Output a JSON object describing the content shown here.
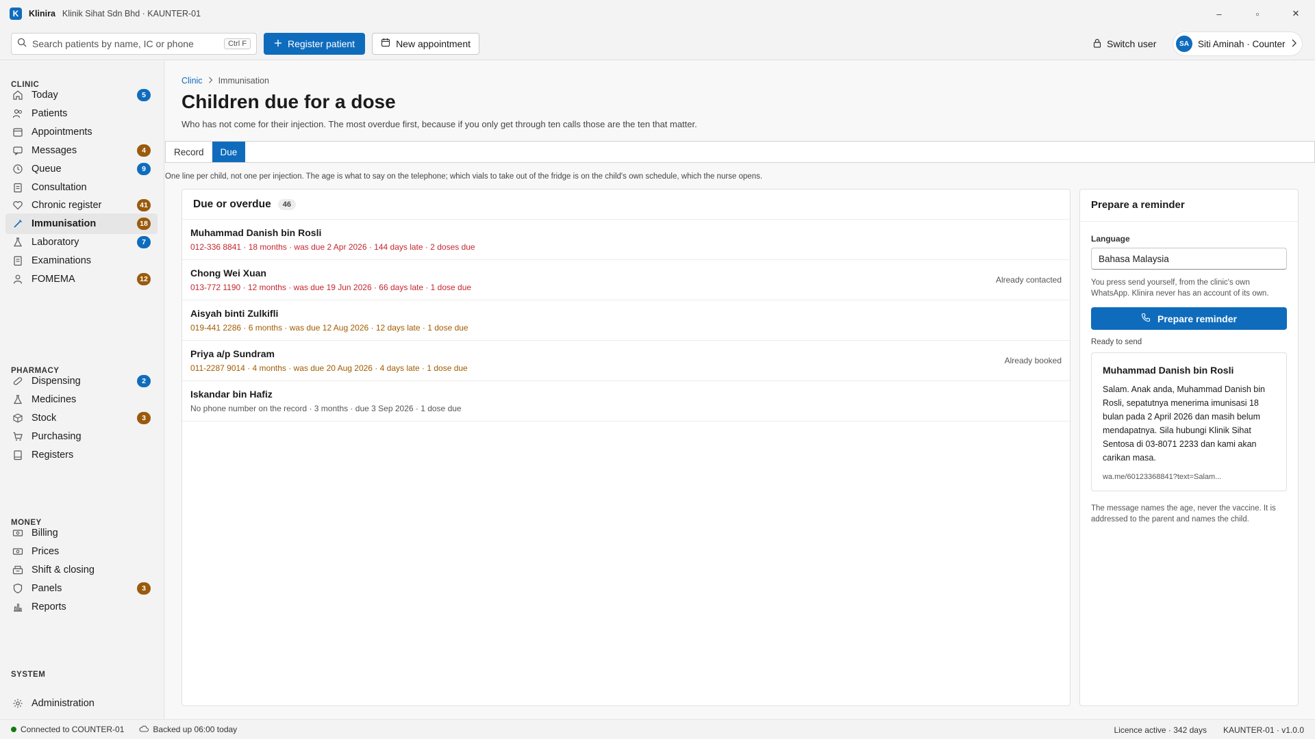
{
  "app": {
    "logo_letter": "K",
    "name": "Klinira",
    "subtitle": "Klinik Sihat Sdn Bhd · KAUNTER-01",
    "window_controls": {
      "minimize": "–",
      "maximize": "▫",
      "close": "✕"
    }
  },
  "toolbar": {
    "search_placeholder": "Search patients by name, IC or phone",
    "search_shortcut": "Ctrl F",
    "register_label": "Register patient",
    "appointment_label": "New appointment",
    "switch_user_label": "Switch user",
    "user_initials": "SA",
    "user_name": "Siti Aminah · Counter"
  },
  "sidebar": {
    "clinic_header": "CLINIC",
    "clinic_items": [
      {
        "label": "Today",
        "icon": "home-icon",
        "badge": "5",
        "badge_color": "blue"
      },
      {
        "label": "Patients",
        "icon": "people-icon",
        "badge": "",
        "badge_color": ""
      },
      {
        "label": "Appointments",
        "icon": "calendar-icon",
        "badge": "",
        "badge_color": ""
      },
      {
        "label": "Messages",
        "icon": "chat-icon",
        "badge": "4",
        "badge_color": "brown"
      },
      {
        "label": "Queue",
        "icon": "clock-icon",
        "badge": "9",
        "badge_color": "blue"
      },
      {
        "label": "Consultation",
        "icon": "clipboard-icon",
        "badge": "",
        "badge_color": ""
      },
      {
        "label": "Chronic register",
        "icon": "heart-icon",
        "badge": "41",
        "badge_color": "brown"
      },
      {
        "label": "Immunisation",
        "icon": "syringe-icon",
        "badge": "18",
        "badge_color": "brown",
        "active": true
      },
      {
        "label": "Laboratory",
        "icon": "flask-icon",
        "badge": "7",
        "badge_color": "blue"
      },
      {
        "label": "Examinations",
        "icon": "document-icon",
        "badge": "",
        "badge_color": ""
      },
      {
        "label": "FOMEMA",
        "icon": "person-icon",
        "badge": "12",
        "badge_color": "brown"
      }
    ],
    "pharmacy_header": "PHARMACY",
    "pharmacy_items": [
      {
        "label": "Dispensing",
        "icon": "pill-icon",
        "badge": "2",
        "badge_color": "blue"
      },
      {
        "label": "Medicines",
        "icon": "flask-icon",
        "badge": "",
        "badge_color": ""
      },
      {
        "label": "Stock",
        "icon": "box-icon",
        "badge": "3",
        "badge_color": "brown"
      },
      {
        "label": "Purchasing",
        "icon": "cart-icon",
        "badge": "",
        "badge_color": ""
      },
      {
        "label": "Registers",
        "icon": "book-icon",
        "badge": "",
        "badge_color": ""
      }
    ],
    "money_header": "MONEY",
    "money_items": [
      {
        "label": "Billing",
        "icon": "money-icon",
        "badge": "",
        "badge_color": ""
      },
      {
        "label": "Prices",
        "icon": "money-icon",
        "badge": "",
        "badge_color": ""
      },
      {
        "label": "Shift & closing",
        "icon": "cash-drawer-icon",
        "badge": "",
        "badge_color": ""
      },
      {
        "label": "Panels",
        "icon": "shield-icon",
        "badge": "3",
        "badge_color": "brown"
      },
      {
        "label": "Reports",
        "icon": "bar-chart-icon",
        "badge": "",
        "badge_color": ""
      }
    ],
    "system_header": "SYSTEM",
    "system_items": [
      {
        "label": "Administration",
        "icon": "gear-icon",
        "badge": "",
        "badge_color": ""
      }
    ]
  },
  "main": {
    "breadcrumb_root": "Clinic",
    "breadcrumb_current": "Immunisation",
    "title": "Children due for a dose",
    "subtitle": "Who has not come for their injection. The most overdue first, because if you only get through ten calls those are the ten that matter.",
    "tabs": [
      "Record",
      "Due"
    ],
    "hint": "One line per child, not one per injection. The age is what to say on the telephone; which vials to take out of the fridge is on the child's own schedule, which the nurse opens.",
    "list_title": "Due or overdue",
    "list_count": "46",
    "rows": [
      {
        "name": "Muhammad Danish bin Rosli",
        "meta": "012-336 8841 · 18 months · was due 2 Apr 2026 · 144 days late · 2 doses due",
        "tone": "red",
        "status": ""
      },
      {
        "name": "Chong Wei Xuan",
        "meta": "013-772 1190 · 12 months · was due 19 Jun 2026 · 66 days late · 1 dose due",
        "tone": "red",
        "status": "Already contacted"
      },
      {
        "name": "Aisyah binti Zulkifli",
        "meta": "019-441 2286 · 6 months · was due 12 Aug 2026 · 12 days late · 1 dose due",
        "tone": "amber",
        "status": ""
      },
      {
        "name": "Priya a/p Sundram",
        "meta": "011-2287 9014 · 4 months · was due 20 Aug 2026 · 4 days late · 1 dose due",
        "tone": "amber",
        "status": "Already booked"
      },
      {
        "name": "Iskandar bin Hafiz",
        "meta": "No phone number on the record · 3 months · due 3 Sep 2026 · 1 dose due",
        "tone": "grey",
        "status": ""
      }
    ]
  },
  "reminder": {
    "title": "Prepare a reminder",
    "language_label": "Language",
    "language_value": "Bahasa Malaysia",
    "note": "You press send yourself, from the clinic's own WhatsApp. Klinira never has an account of its own.",
    "button_label": "Prepare reminder",
    "ready_label": "Ready to send",
    "message_name": "Muhammad Danish bin Rosli",
    "message_body": "Salam. Anak anda, Muhammad Danish bin Rosli, sepatutnya menerima imunisasi 18 bulan pada 2 April 2026 dan masih belum mendapatnya. Sila hubungi Klinik Sihat Sentosa di 03-8071 2233 dan kami akan carikan masa.",
    "message_link": "wa.me/60123368841?text=Salam...",
    "footer_note": "The message names the age, never the vaccine. It is addressed to the parent and names the child."
  },
  "statusbar": {
    "connection": "Connected to COUNTER-01",
    "backup": "Backed up 06:00 today",
    "licence": "Licence active · 342 days",
    "version": "KAUNTER-01 · v1.0.0"
  },
  "colors": {
    "accent": "#0f6cbd",
    "overdue_red": "#c4262e",
    "late_amber": "#a15c00",
    "badge_brown": "#9a5a0d",
    "online_green": "#107c10"
  }
}
